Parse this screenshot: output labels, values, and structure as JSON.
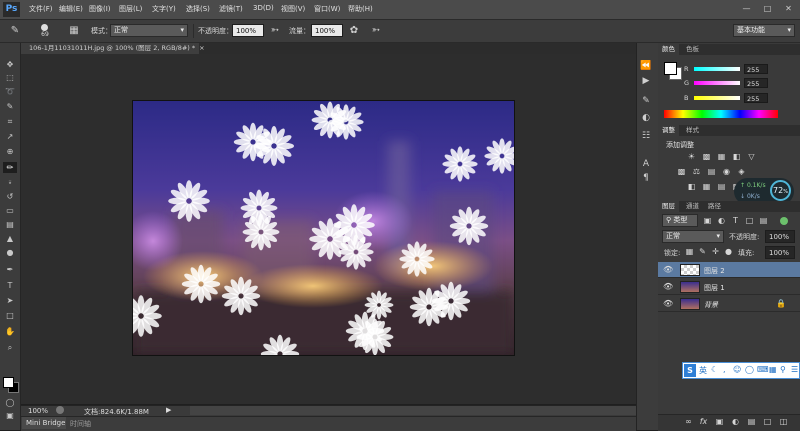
{
  "app": {
    "logo": "Ps",
    "menu": [
      "文件(F)",
      "编辑(E)",
      "图像(I)",
      "图层(L)",
      "文字(Y)",
      "选择(S)",
      "滤镜(T)",
      "3D(D)",
      "视图(V)",
      "窗口(W)",
      "帮助(H)"
    ],
    "window_controls": [
      "—",
      "□",
      "✕"
    ]
  },
  "options": {
    "brush_size": "69",
    "mode_label": "模式：",
    "mode_value": "正常",
    "opacity_label": "不透明度：",
    "opacity_value": "100%",
    "flow_label": "流量：",
    "flow_value": "100%",
    "workspace": "基本功能"
  },
  "document": {
    "tab_title": "106-1月11031011H.jpg @ 100% (图层 2, RGB/8#) *",
    "zoom": "100%",
    "doc_info": "文档:824.6K/1.88M"
  },
  "bottom": {
    "mini_bridge": "Mini Bridge",
    "timeline": "时间轴"
  },
  "color_panel": {
    "tabs": [
      "颜色",
      "色板"
    ],
    "channels": [
      {
        "name": "R",
        "value": "255"
      },
      {
        "name": "G",
        "value": "255"
      },
      {
        "name": "B",
        "value": "255"
      }
    ]
  },
  "adjustments_panel": {
    "tabs": [
      "调整",
      "样式"
    ],
    "title": "添加调整"
  },
  "layers_panel": {
    "tabs": [
      "图层",
      "通道",
      "路径"
    ],
    "filter_kind": "类型",
    "blend_mode": "正常",
    "opacity_label": "不透明度:",
    "opacity_value": "100%",
    "lock_label": "锁定:",
    "fill_label": "填充:",
    "fill_value": "100%",
    "layers": [
      {
        "name": "图层 2",
        "selected": true
      },
      {
        "name": "图层 1",
        "selected": false
      },
      {
        "name": "背景",
        "selected": false
      }
    ]
  },
  "net_widget": {
    "percent": "72",
    "percent_unit": "%",
    "up": "0.1",
    "up_unit": "K/s",
    "down": "0",
    "down_unit": "K/s"
  },
  "ime": {
    "lang": "英",
    "mode": "S"
  },
  "colors": {
    "layer_selected": "#5b7aa1",
    "accent_blue": "#59a9ff"
  }
}
